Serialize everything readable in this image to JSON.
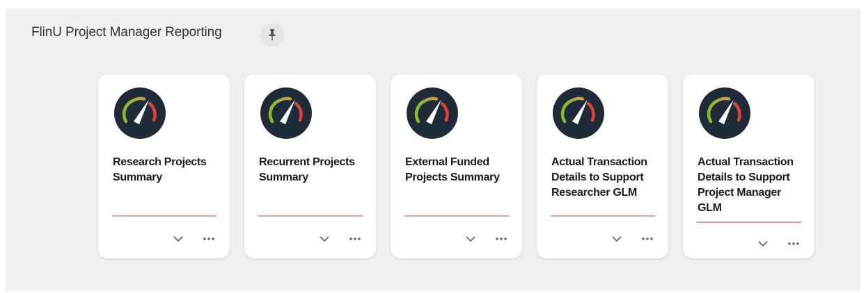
{
  "header": {
    "title": "FlinU Project Manager Reporting",
    "pin_icon": "pin-icon"
  },
  "tiles": [
    {
      "title": "Research Projects Summary",
      "icon": "gauge-icon"
    },
    {
      "title": "Recurrent Projects Summary",
      "icon": "gauge-icon"
    },
    {
      "title": "External Funded Projects Summary",
      "icon": "gauge-icon"
    },
    {
      "title": "Actual Transaction Details to Support Researcher GLM",
      "icon": "gauge-icon"
    },
    {
      "title": "Actual Transaction Details to Support Project Manager GLM",
      "icon": "gauge-icon"
    }
  ],
  "colors": {
    "panel_bg": "#f0f0f0",
    "card_bg": "#ffffff",
    "gauge_bg": "#1f2b38",
    "gauge_green": "#8fb832",
    "gauge_red": "#d9453c",
    "divider": "#e89a9a"
  }
}
